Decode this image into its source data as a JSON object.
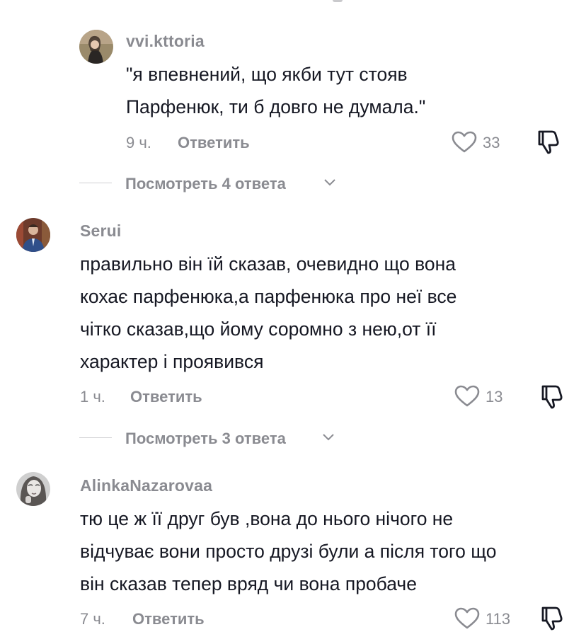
{
  "comments": [
    {
      "username": "vvi.kttoria",
      "text_lines": [
        "\"я впевнений, що якби тут стояв",
        "Парфенюк, ти б довго не думала.\""
      ],
      "time": "9 ч.",
      "reply_label": "Ответить",
      "likes": "33",
      "view_replies": "Посмотреть 4 ответа"
    },
    {
      "username": "Serui",
      "text_lines": [
        "правильно він їй сказав, очевидно що вона",
        "кохає парфенюка,а парфенюка про неї все",
        "чітко сказав,що йому соромно з нею,от її",
        "характер і проявився"
      ],
      "time": "1 ч.",
      "reply_label": "Ответить",
      "likes": "13",
      "view_replies": "Посмотреть 3 ответа"
    },
    {
      "username": "AlinkaNazarovaa",
      "text_lines": [
        "тю це ж її друг був ,вона до нього нічого не",
        "відчуває вони просто друзі були а після того що",
        "він сказав тепер вряд чи вона пробаче"
      ],
      "time": "7 ч.",
      "reply_label": "Ответить",
      "likes": "113"
    }
  ],
  "icons": {
    "like": "heart-outline-icon",
    "dislike": "thumbs-down-outline-icon",
    "expand": "chevron-down-icon"
  },
  "colors": {
    "text": "#161823",
    "secondary": "#8a8b91",
    "divider": "#d0d0d3"
  }
}
